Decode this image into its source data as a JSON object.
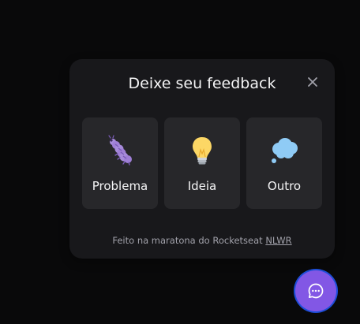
{
  "widget": {
    "title": "Deixe seu feedback",
    "close_icon": "close-icon",
    "options": [
      {
        "label": "Problema",
        "icon": "bug-icon"
      },
      {
        "label": "Ideia",
        "icon": "lightbulb-icon"
      },
      {
        "label": "Outro",
        "icon": "thought-bubble-icon"
      }
    ],
    "footer": {
      "text": "Feito na maratona do Rocketseat",
      "link": "NLWR"
    }
  },
  "fab": {
    "icon": "chat-bubble-icon",
    "color": "#8257e5"
  },
  "colors": {
    "background": "#09090a",
    "surface": "#18181b",
    "card": "#27272a",
    "accent": "#8257e5"
  }
}
